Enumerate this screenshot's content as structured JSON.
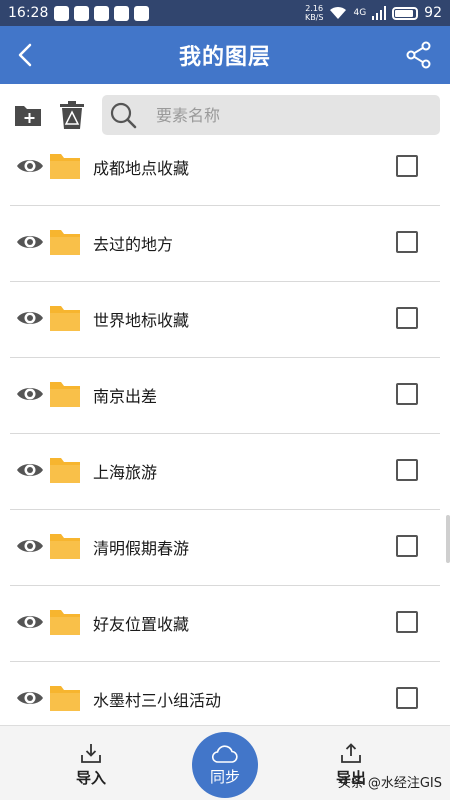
{
  "status_bar": {
    "time": "16:28",
    "speed_value": "2.16",
    "speed_unit": "KB/S",
    "network": "4G",
    "battery": "92"
  },
  "header": {
    "title": "我的图层",
    "back_icon": "back-arrow-icon",
    "share_icon": "share-icon"
  },
  "toolbar": {
    "add_folder_icon": "add-folder-icon",
    "delete_icon": "trash-icon",
    "search_placeholder": "要素名称"
  },
  "layers": [
    {
      "name": "成都地点收藏"
    },
    {
      "name": "去过的地方"
    },
    {
      "name": "世界地标收藏"
    },
    {
      "name": "南京出差"
    },
    {
      "name": "上海旅游"
    },
    {
      "name": "清明假期春游"
    },
    {
      "name": "好友位置收藏"
    },
    {
      "name": "水墨村三小组活动"
    }
  ],
  "bottom_bar": {
    "import_label": "导入",
    "sync_label": "同步",
    "export_label": "导出"
  },
  "watermark": "头条 @水经注GIS",
  "colors": {
    "header": "#4276c9",
    "status_bar": "#31456e",
    "folder": "#f7b52f",
    "sync_button": "#4276c9"
  }
}
